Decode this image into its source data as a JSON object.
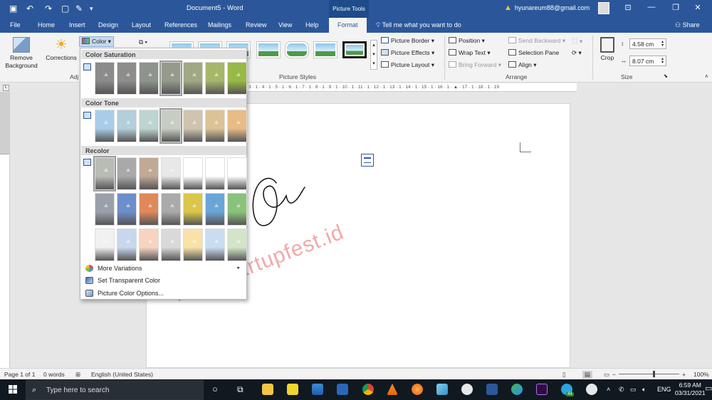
{
  "titlebar": {
    "title": "Document5 - Word",
    "context_tab": "Picture Tools",
    "account": "hyunareum88@gmail.com",
    "share": "Share"
  },
  "tabs": [
    "File",
    "Home",
    "Insert",
    "Design",
    "Layout",
    "References",
    "Mailings",
    "Review",
    "View",
    "Help",
    "Format"
  ],
  "tellme": "Tell me what you want to do",
  "ribbon": {
    "remove_bg": "Remove Background",
    "corrections": "Corrections",
    "color": "Color",
    "adjust_partial": "Adj",
    "picture_styles": "Picture Styles",
    "picture_border": "Picture Border",
    "picture_effects": "Picture Effects",
    "picture_layout": "Picture Layout",
    "position": "Position",
    "wrap_text": "Wrap Text",
    "bring_forward": "Bring Forward",
    "send_backward": "Send Backward",
    "selection_pane": "Selection Pane",
    "align": "Align",
    "arrange": "Arrange",
    "crop": "Crop",
    "height": "4.58 cm",
    "width": "8.07 cm",
    "size": "Size"
  },
  "ruler": {
    "ticks": "· 3 · 1 · 4 · 1 · 5 · 1 · 6 · 1 · 7 · 1 · 8 · 1 · 9 · 1 · 10 · 1 · 11 · 1 · 12 · 1 · 13 · 1 · 14 · 1 · 15 · 1 · 16 · 1 · ▲ · 17 · 1 · 18 · 1 · 19"
  },
  "dropdown": {
    "saturation_title": "Color Saturation",
    "tone_title": "Color Tone",
    "recolor_title": "Recolor",
    "more_variations": "More Variations",
    "set_transparent": "Set Transparent Color",
    "color_options": "Picture Color Options...",
    "saturation_colors": [
      "#8b8b8b",
      "#8d8d8c",
      "#8e938d",
      "#949a8c",
      "#a0a983",
      "#a6b66a",
      "#98b945"
    ],
    "tone_colors": [
      "#a9cde8",
      "#b2cfdb",
      "#bed4d0",
      "#c8cdc3",
      "#cfc4ad",
      "#dcc297",
      "#e7bc85"
    ],
    "recolor_row1": [
      "#b9bcb4",
      "#a9a9a9",
      "#c0a995",
      "#e8e8e8",
      "#ffffff",
      "#ffffff",
      "#ffffff"
    ],
    "recolor_row2": [
      "#9aa0ab",
      "#6d8ecb",
      "#e0885a",
      "#aaaaaa",
      "#d9c64a",
      "#6aa5d8",
      "#89c27a"
    ],
    "recolor_row3": [
      "#f1f1f1",
      "#c9d6ee",
      "#f6d4c0",
      "#d9d9d9",
      "#f9e2a8",
      "#c9dcf0",
      "#d2e5c8"
    ]
  },
  "watermark": "localstartupfest.id",
  "status": {
    "page": "Page 1 of 1",
    "words": "0 words",
    "language": "English (United States)",
    "zoom": "100%"
  },
  "taskbar": {
    "search": "Type here to search",
    "time": "6:59 AM",
    "date": "03/31/2021",
    "lang": "ENG",
    "badge": "44"
  }
}
